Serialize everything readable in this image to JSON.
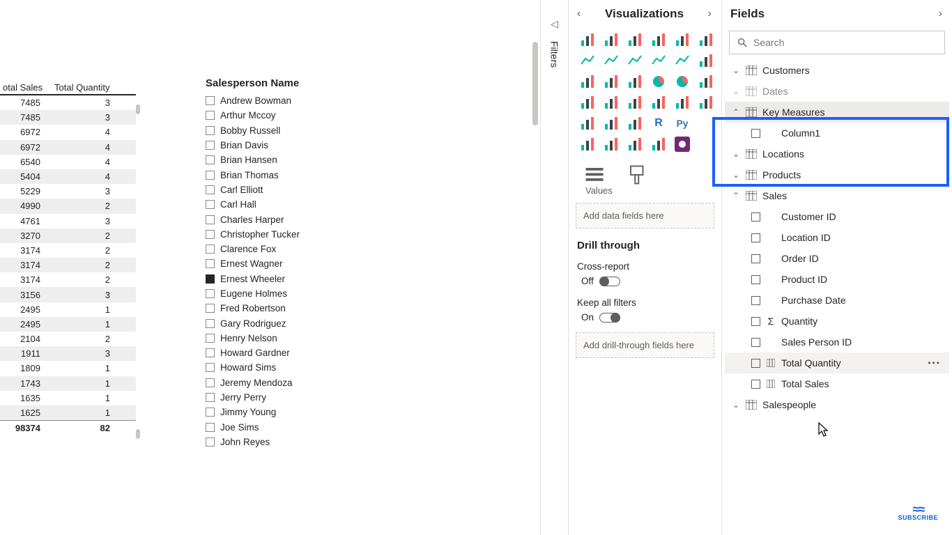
{
  "table": {
    "headers": {
      "sales": "otal Sales",
      "qty": "Total Quantity"
    },
    "rows": [
      {
        "sales": "7485",
        "qty": "3"
      },
      {
        "sales": "7485",
        "qty": "3"
      },
      {
        "sales": "6972",
        "qty": "4"
      },
      {
        "sales": "6972",
        "qty": "4"
      },
      {
        "sales": "6540",
        "qty": "4"
      },
      {
        "sales": "5404",
        "qty": "4"
      },
      {
        "sales": "5229",
        "qty": "3"
      },
      {
        "sales": "4990",
        "qty": "2"
      },
      {
        "sales": "4761",
        "qty": "3"
      },
      {
        "sales": "3270",
        "qty": "2"
      },
      {
        "sales": "3174",
        "qty": "2"
      },
      {
        "sales": "3174",
        "qty": "2"
      },
      {
        "sales": "3174",
        "qty": "2"
      },
      {
        "sales": "3156",
        "qty": "3"
      },
      {
        "sales": "2495",
        "qty": "1"
      },
      {
        "sales": "2495",
        "qty": "1"
      },
      {
        "sales": "2104",
        "qty": "2"
      },
      {
        "sales": "1911",
        "qty": "3"
      },
      {
        "sales": "1809",
        "qty": "1"
      },
      {
        "sales": "1743",
        "qty": "1"
      },
      {
        "sales": "1635",
        "qty": "1"
      },
      {
        "sales": "1625",
        "qty": "1"
      }
    ],
    "footer": {
      "sales": "98374",
      "qty": "82"
    }
  },
  "slicer": {
    "title": "Salesperson Name",
    "items": [
      {
        "label": "Andrew Bowman",
        "checked": false
      },
      {
        "label": "Arthur Mccoy",
        "checked": false
      },
      {
        "label": "Bobby Russell",
        "checked": false
      },
      {
        "label": "Brian Davis",
        "checked": false
      },
      {
        "label": "Brian Hansen",
        "checked": false
      },
      {
        "label": "Brian Thomas",
        "checked": false
      },
      {
        "label": "Carl Elliott",
        "checked": false
      },
      {
        "label": "Carl Hall",
        "checked": false
      },
      {
        "label": "Charles Harper",
        "checked": false
      },
      {
        "label": "Christopher Tucker",
        "checked": false
      },
      {
        "label": "Clarence Fox",
        "checked": false
      },
      {
        "label": "Ernest Wagner",
        "checked": false
      },
      {
        "label": "Ernest Wheeler",
        "checked": true
      },
      {
        "label": "Eugene Holmes",
        "checked": false
      },
      {
        "label": "Fred Robertson",
        "checked": false
      },
      {
        "label": "Gary Rodriguez",
        "checked": false
      },
      {
        "label": "Henry Nelson",
        "checked": false
      },
      {
        "label": "Howard Gardner",
        "checked": false
      },
      {
        "label": "Howard Sims",
        "checked": false
      },
      {
        "label": "Jeremy Mendoza",
        "checked": false
      },
      {
        "label": "Jerry Perry",
        "checked": false
      },
      {
        "label": "Jimmy Young",
        "checked": false
      },
      {
        "label": "Joe Sims",
        "checked": false
      },
      {
        "label": "John Reyes",
        "checked": false
      }
    ]
  },
  "filters": {
    "label": "Filters"
  },
  "viz": {
    "title": "Visualizations",
    "values_label": "Values",
    "values_placeholder": "Add data fields here",
    "drill_title": "Drill through",
    "cross_report": "Cross-report",
    "off_label": "Off",
    "keep_filters": "Keep all filters",
    "on_label": "On",
    "drill_placeholder": "Add drill-through fields here"
  },
  "fields": {
    "title": "Fields",
    "search_placeholder": "Search",
    "tables": {
      "customers": "Customers",
      "dates": "Dates",
      "key_measures": "Key Measures",
      "key_measures_col": "Column1",
      "locations": "Locations",
      "products": "Products",
      "sales": "Sales",
      "sales_fields": {
        "customer_id": "Customer ID",
        "location_id": "Location ID",
        "order_id": "Order ID",
        "product_id": "Product ID",
        "purchase_date": "Purchase Date",
        "quantity": "Quantity",
        "sales_person_id": "Sales Person ID",
        "total_quantity": "Total Quantity",
        "total_sales": "Total Sales"
      },
      "salespeople": "Salespeople"
    }
  },
  "badge": "SUBSCRIBE"
}
